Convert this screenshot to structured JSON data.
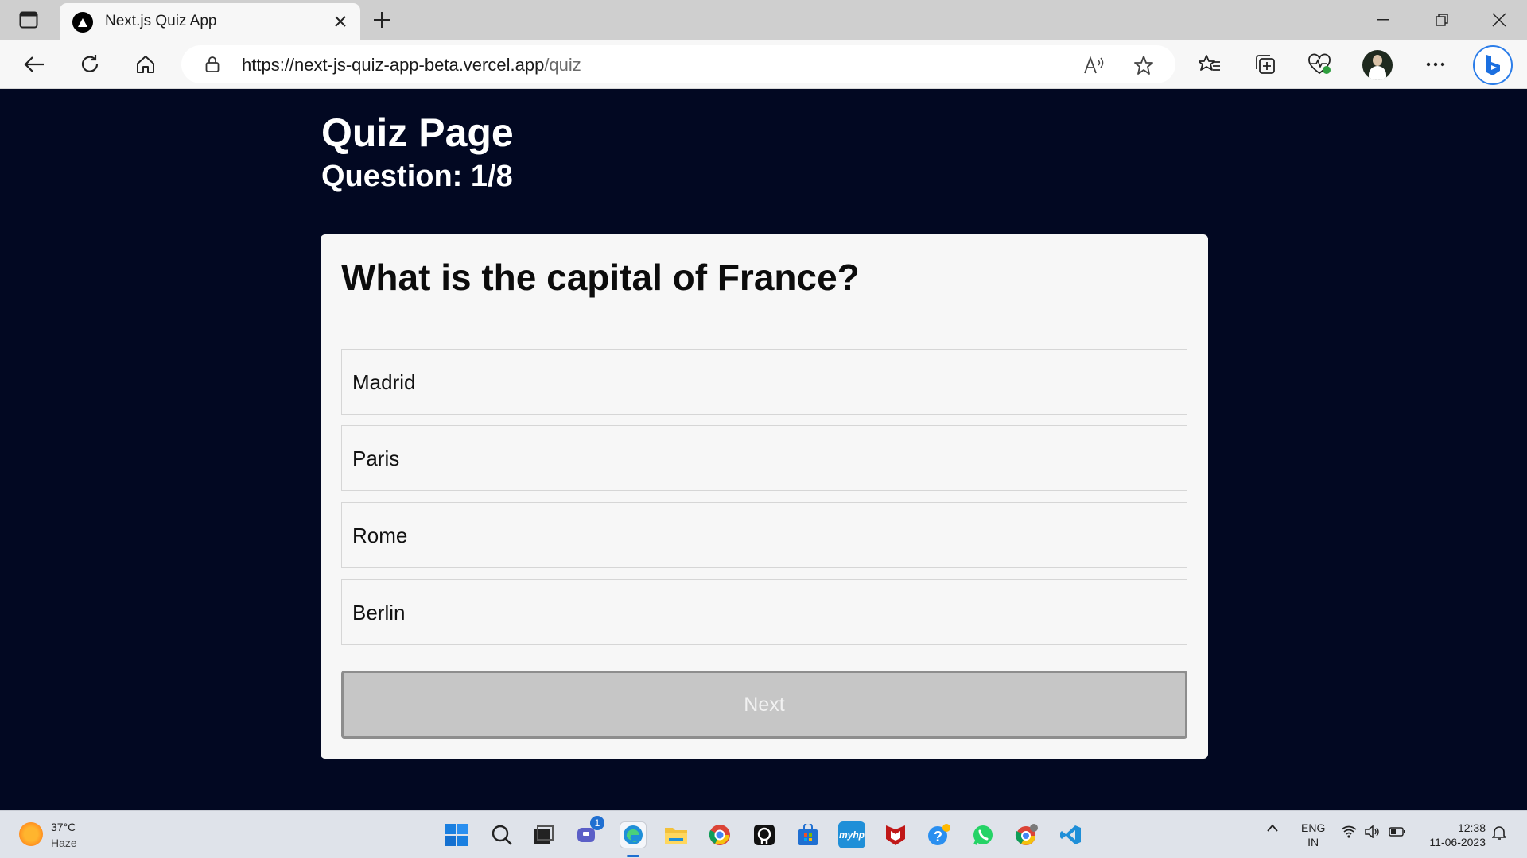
{
  "browser": {
    "tab_title": "Next.js Quiz App",
    "url_main": "https://next-js-quiz-app-beta.vercel.app",
    "url_path": "/quiz"
  },
  "page": {
    "title": "Quiz Page",
    "question_counter": "Question: 1/8",
    "question": "What is the capital of France?",
    "options": [
      "Madrid",
      "Paris",
      "Rome",
      "Berlin"
    ],
    "next_label": "Next"
  },
  "taskbar": {
    "weather_temp": "37°C",
    "weather_condition": "Haze",
    "chat_badge": "1",
    "app_label_hp": "myhp",
    "lang_top": "ENG",
    "lang_bottom": "IN",
    "time": "12:38",
    "date": "11-06-2023"
  },
  "colors": {
    "page_background": "#020822",
    "card_background": "#f7f7f7",
    "next_button_disabled": "#c6c6c6"
  }
}
